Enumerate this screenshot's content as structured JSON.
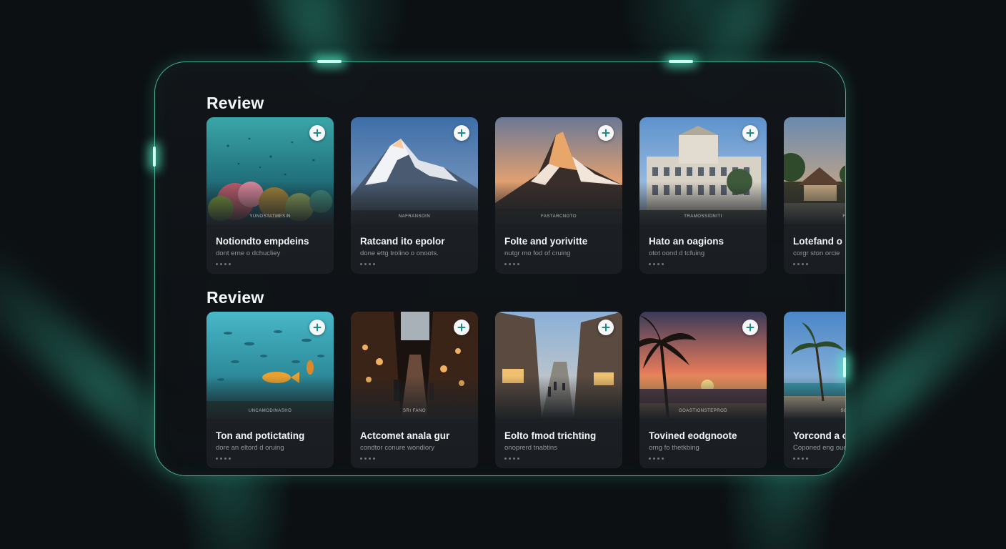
{
  "accent_color": "#5adcb4",
  "sections": [
    {
      "title": "Review",
      "cards": [
        {
          "scene": "reef",
          "title": "Notiondto empdeins",
          "subtitle": "dont erne o dchucliey",
          "caption": "YUNOSTATMESIN"
        },
        {
          "scene": "mountain-snow",
          "title": "Ratcand ito epolor",
          "subtitle": "done ettg trolino o onoots.",
          "caption": "NAFRANSOIN"
        },
        {
          "scene": "mountain-dusk",
          "title": "Folte and yorivitte",
          "subtitle": "nutgr mo fod of cruing",
          "caption": "FASTARCNOTO"
        },
        {
          "scene": "palace",
          "title": "Hato an oagions",
          "subtitle": "otot oond d tcfuing",
          "caption": "TRAMOSSIDNITI"
        },
        {
          "scene": "beach-house",
          "title": "Lotefand o",
          "subtitle": "corgr ston orcie",
          "caption": "FAN"
        }
      ]
    },
    {
      "title": "Review",
      "cards": [
        {
          "scene": "fish",
          "title": "Ton and potictating",
          "subtitle": "dore an eltord d oruing",
          "caption": "UNCAMODINASHO"
        },
        {
          "scene": "market-night",
          "title": "Actcomet anala gur",
          "subtitle": "condtor conure wondiory",
          "caption": "SRI FANO"
        },
        {
          "scene": "market-street",
          "title": "Eolto fmod trichting",
          "subtitle": "onoprerd tnabtins",
          "caption": ""
        },
        {
          "scene": "sunset-palm",
          "title": "Tovined eodgnoote",
          "subtitle": "orng fo thetkbing",
          "caption": "GOASTIONSTEPROD"
        },
        {
          "scene": "palm-beach",
          "title": "Yorcond a o",
          "subtitle": "Coponed eng oue",
          "caption": "SONE"
        }
      ]
    }
  ]
}
